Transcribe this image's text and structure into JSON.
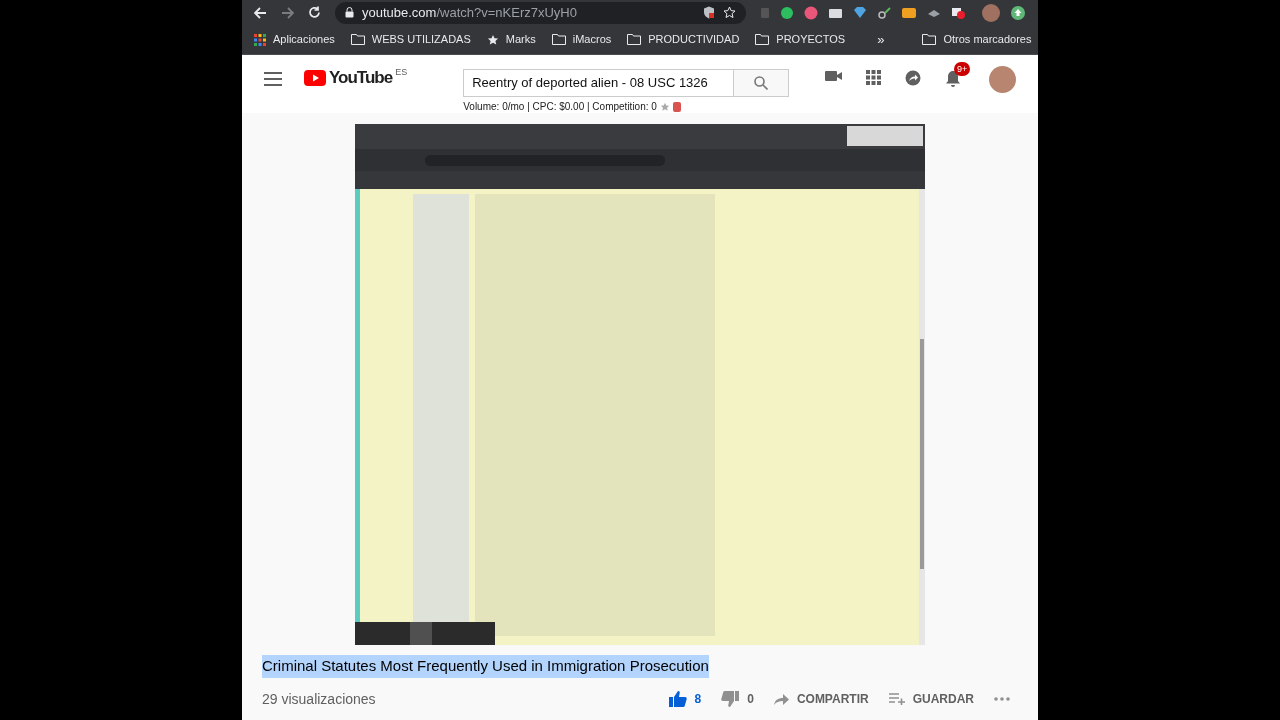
{
  "browser": {
    "url": {
      "host": "youtube.com",
      "path": "/watch?v=nKErz7xUyH0"
    },
    "bookmarks": [
      {
        "kind": "apps",
        "label": "Aplicaciones"
      },
      {
        "kind": "folder",
        "label": "WEBS UTILIZADAS"
      },
      {
        "kind": "star",
        "label": "Marks"
      },
      {
        "kind": "folder",
        "label": "iMacros"
      },
      {
        "kind": "folder",
        "label": "PRODUCTIVIDAD"
      },
      {
        "kind": "folder",
        "label": "PROYECTOS"
      }
    ],
    "overflow": "»",
    "other_bookmarks": "Otros marcadores"
  },
  "header": {
    "logo": "YouTube",
    "region": "ES",
    "search_value": "Reentry of deported alien - 08 USC 1326",
    "keyword_stats": "Volume: 0/mo | CPC: $0.00 | Competition: 0",
    "notification_count": "9+"
  },
  "video": {
    "title": "Criminal Statutes Most Frequently Used in Immigration Prosecution",
    "title_highlighted": true,
    "views": "29 visualizaciones",
    "actions": [
      {
        "kind": "like",
        "label": "8",
        "selected": true
      },
      {
        "kind": "dislike",
        "label": "0",
        "selected": false
      },
      {
        "kind": "share",
        "label": "COMPARTIR"
      },
      {
        "kind": "save",
        "label": "GUARDAR"
      },
      {
        "kind": "more"
      }
    ]
  }
}
